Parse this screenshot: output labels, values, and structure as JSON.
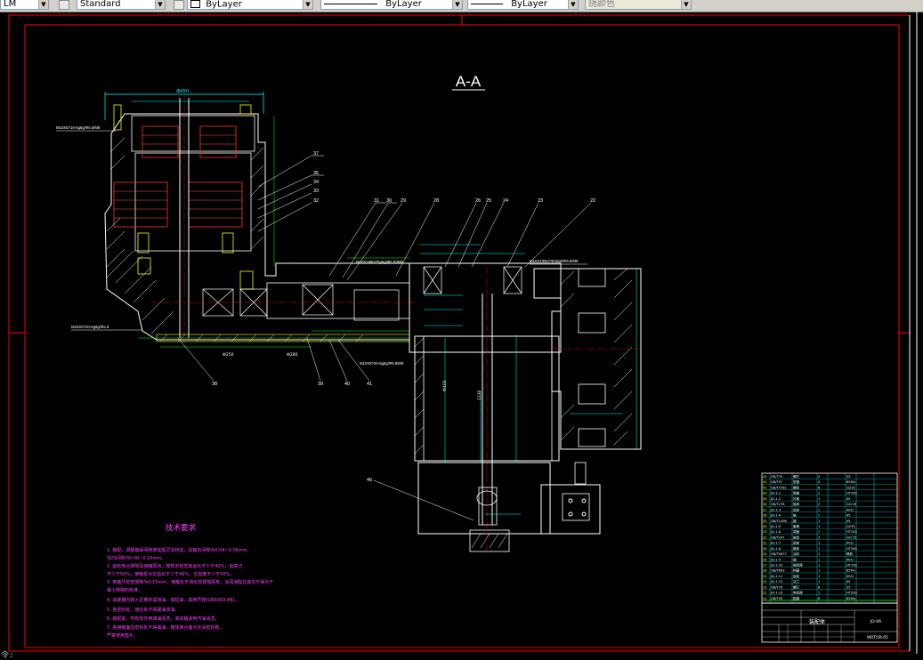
{
  "toolbar": {
    "text_style_value": "Standard",
    "left_partial_value": "LM",
    "layer_value": "ByLayer",
    "linetype_value": "ByLayer",
    "lineweight_value": "ByLayer",
    "plotstyle_value": "随颜色"
  },
  "drawing": {
    "section_title": "A-A",
    "tech_title": "技术要求",
    "tech_lines": [
      "1. 装配、调整轴承间隙使其能灵活转动，具轴向间隙为0.04~0.06mm,",
      "   径向间隙为0.08~0.10mm。",
      "2. 齿轮啮合侧隙及接触斑点，按规定检查其齿长不少于40%，齿高方",
      "   不少于50%，接触斑点在齿长不少于40%，在齿宽不少于50%。",
      "3. 用塞尺检查侧隙为0.15mm，接触处不得出现锈蚀现象，涂润滑脂在其中不得大于",
      "   最小侧隙的标准。",
      "4. 减速器内装入足量的润滑油，如机油，其牌号按(GB5903-86)。",
      "5. 各密封处、接合处不得漏油渗油。",
      "6. 装配前，所有零件用煤油清洗，滚动轴承用汽油清洗。",
      "7. 各接触面及密封处不得漏油，箱体接合面允许涂密封胶，",
      "   严禁使用垫片。"
    ],
    "part_numbers": [
      "37",
      "35",
      "34",
      "33",
      "32",
      "31",
      "30",
      "29",
      "28",
      "26",
      "25",
      "24",
      "23",
      "22",
      "38",
      "39",
      "40",
      "41",
      "46"
    ],
    "spec_label_1": "M10X5?16-5g6g/Ф5.8/M8",
    "spec_label_2": "M10X5?20-5g6g/Ф5.8",
    "spec_label_3": "M10X5?20-5g6g/Ф5.8/M8",
    "spec_label_4": "M10X1Ф63?Ф40g6/Ф5.8/M8",
    "spec_label_5": "M10X1Ф63?5g6g(Ф5.8)/M8",
    "dim_top": "Ф450",
    "dim_bottom_1": "Ф250",
    "dim_bottom_2": "Ф280",
    "dim_vertical_1": "Ф100",
    "dim_vertical_2": "1130",
    "title_block_title": "装配体",
    "title_block_code": "JQ-06",
    "title_block_drawing_no": "MOTOR-05",
    "bom_rows": [
      [
        "43",
        "GB/T70",
        "螺钉",
        "4",
        "35"
      ],
      [
        "42",
        "GB/T97",
        "垫圈",
        "4",
        "65Mn"
      ],
      [
        "41",
        "GB/T5781",
        "螺栓",
        "8",
        "Q235"
      ],
      [
        "40",
        "JQ-1-1",
        "端盖",
        "1",
        "HT150"
      ],
      [
        "39",
        "JQ-1-2",
        "衬套",
        "1",
        "45"
      ],
      [
        "38",
        "GB/T276",
        "轴承",
        "2",
        "GCr15"
      ],
      [
        "37",
        "JQ-1-3",
        "齿轮",
        "1",
        "40Cr"
      ],
      [
        "36",
        "JQ-1-4",
        "轴",
        "1",
        "45"
      ],
      [
        "35",
        "GB/T1096",
        "键",
        "1",
        "45"
      ],
      [
        "34",
        "JQ-1-5",
        "套筒",
        "1",
        "Q235"
      ],
      [
        "33",
        "JQ-1-6",
        "端盖",
        "1",
        "HT150"
      ],
      [
        "32",
        "GB/T297",
        "轴承",
        "2",
        "GCr15"
      ],
      [
        "31",
        "JQ-1-7",
        "齿轮",
        "1",
        "40Cr"
      ],
      [
        "30",
        "JQ-1-8",
        "箱体",
        "1",
        "HT200"
      ],
      [
        "29",
        "GB/T9877",
        "油封",
        "1",
        "橡胶"
      ],
      [
        "28",
        "JQ-1-9",
        "轴",
        "1",
        "40Cr"
      ],
      [
        "27",
        "JQ-1-10",
        "轴承座",
        "1",
        "HT150"
      ],
      [
        "26",
        "GB/T893",
        "挡圈",
        "1",
        "65Mn"
      ],
      [
        "25",
        "JQ-1-11",
        "齿轮",
        "1",
        "40Cr"
      ],
      [
        "24",
        "JQ-1-12",
        "法兰",
        "1",
        "45"
      ],
      [
        "23",
        "GB/T70",
        "螺钉",
        "6",
        "35"
      ],
      [
        "22",
        "JQ-1-13",
        "电机座",
        "1",
        "HT200"
      ],
      [
        "21",
        "GB/T93",
        "垫圈",
        "6",
        "65Mn"
      ]
    ]
  }
}
